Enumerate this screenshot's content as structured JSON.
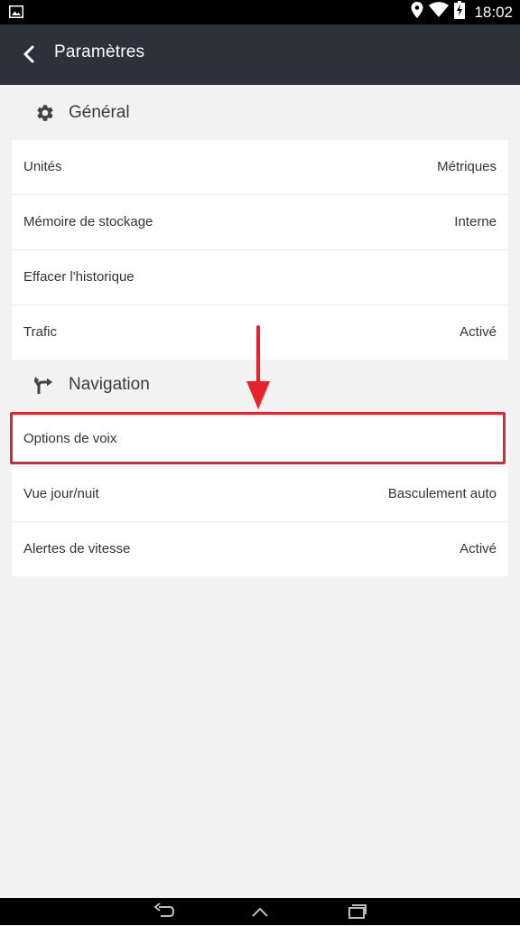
{
  "status_bar": {
    "time": "18:02",
    "icons": [
      "gallery-icon",
      "location-icon",
      "wifi-icon",
      "battery-charging-icon"
    ]
  },
  "header": {
    "title": "Paramètres",
    "back_icon": "chevron-left-icon"
  },
  "sections": [
    {
      "title": "Général",
      "icon": "gear-icon",
      "items": [
        {
          "label": "Unités",
          "value": "Métriques"
        },
        {
          "label": "Mémoire de stockage",
          "value": "Interne"
        },
        {
          "label": "Effacer l'historique",
          "value": ""
        },
        {
          "label": "Trafic",
          "value": "Activé"
        }
      ]
    },
    {
      "title": "Navigation",
      "icon": "route-icon",
      "items": [
        {
          "label": "Options de voix",
          "value": ""
        },
        {
          "label": "Vue jour/nuit",
          "value": "Basculement auto"
        },
        {
          "label": "Alertes de vitesse",
          "value": "Activé"
        }
      ]
    }
  ],
  "annotation": {
    "highlight_color": "#e5232d",
    "highlighted_item": "Options de voix"
  },
  "colors": {
    "app_bar": "#2d313b",
    "background": "#f2f2f2",
    "card": "#ffffff"
  },
  "nav_bar": {
    "icons": [
      "back-icon",
      "home-icon",
      "recent-apps-icon"
    ]
  }
}
